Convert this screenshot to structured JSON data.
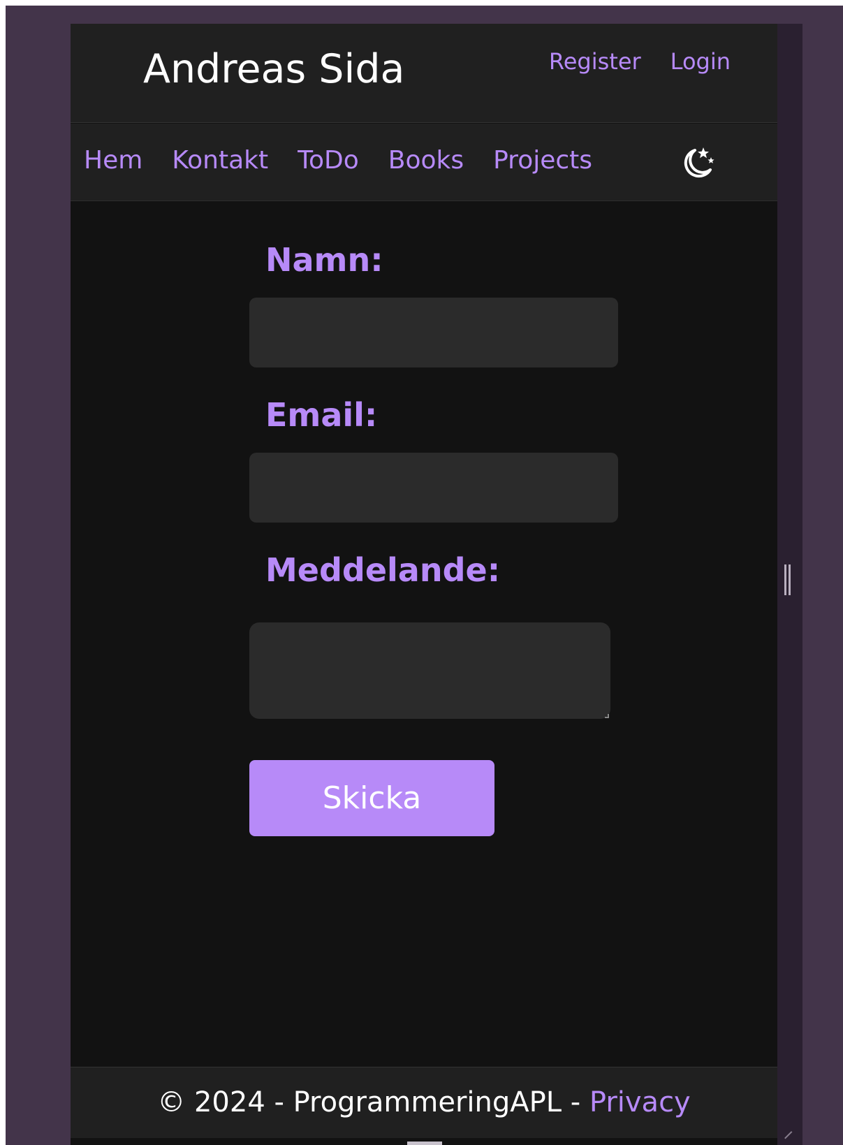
{
  "header": {
    "brand": "Andreas Sida",
    "auth_links": [
      "Register",
      "Login"
    ]
  },
  "nav": {
    "links": [
      "Hem",
      "Kontakt",
      "ToDo",
      "Books",
      "Projects"
    ],
    "theme_toggle_icon": "moon-stars-icon"
  },
  "form": {
    "name_label": "Namn:",
    "name_value": "",
    "email_label": "Email:",
    "email_value": "",
    "message_label": "Meddelande:",
    "message_value": "",
    "submit_label": "Skicka"
  },
  "footer": {
    "copyright": "© 2024 - ProgrammeringAPL - ",
    "privacy_link": "Privacy"
  },
  "colors": {
    "accent": "#b78af8",
    "page_background": "#121212",
    "header_background": "#202020",
    "input_background": "#2b2b2b",
    "outer_background": "#43344a"
  }
}
